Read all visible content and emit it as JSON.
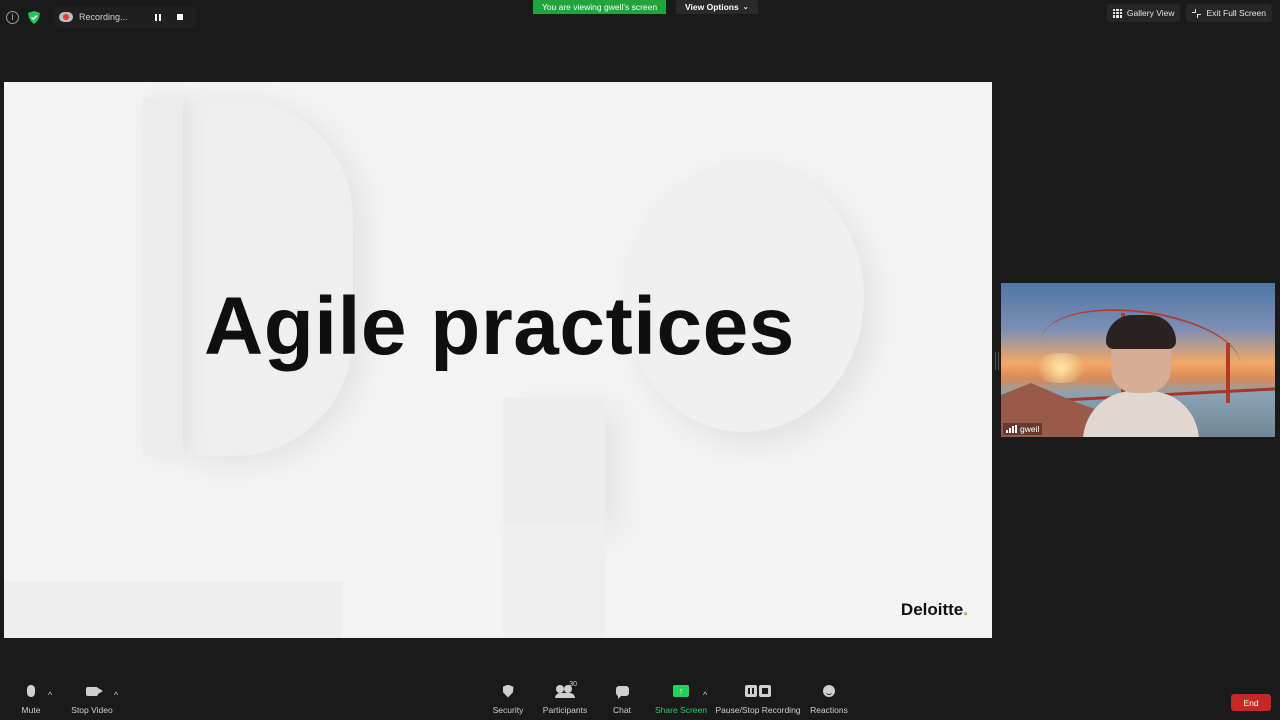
{
  "top_bar": {
    "recording_label": "Recording...",
    "viewing_banner": "You are viewing gwell's screen",
    "view_options_label": "View Options",
    "gallery_view_label": "Gallery View",
    "exit_full_screen_label": "Exit Full Screen"
  },
  "slide": {
    "title": "Agile practices",
    "brand": "Deloitte",
    "brand_dot": "."
  },
  "video": {
    "participant_name": "gweil"
  },
  "toolbar": {
    "mute": "Mute",
    "stop_video": "Stop Video",
    "security": "Security",
    "participants": "Participants",
    "participants_count": "30",
    "chat": "Chat",
    "share_screen": "Share Screen",
    "pause_stop_recording": "Pause/Stop Recording",
    "reactions": "Reactions",
    "end": "End"
  },
  "colors": {
    "accent_green": "#22a33b",
    "share_green": "#23d160",
    "end_red": "#c62828",
    "brand_green": "#86bc25"
  }
}
